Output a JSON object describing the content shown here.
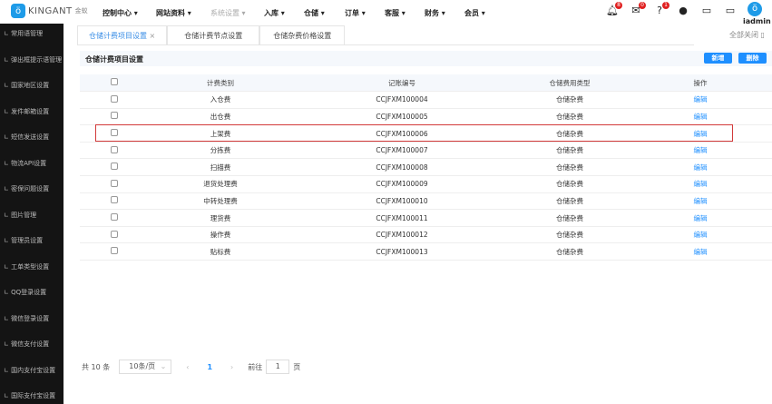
{
  "brand": {
    "name": "KINGANT",
    "cn": "金蚁"
  },
  "topnav": [
    {
      "label": "控制中心 ▾"
    },
    {
      "label": "网站资料 ▾"
    },
    {
      "label": "系统设置 ▾"
    },
    {
      "label": "入库 ▾"
    },
    {
      "label": "仓储 ▾"
    },
    {
      "label": "订单 ▾"
    },
    {
      "label": "客服 ▾"
    },
    {
      "label": "财务 ▾"
    },
    {
      "label": "会员 ▾"
    }
  ],
  "header_icons": {
    "notifications": "8",
    "messages": "0",
    "help": "1"
  },
  "user": {
    "name": "iadmin"
  },
  "sidebar": [
    "常用语管理",
    "弹出框提示语管理",
    "国家地区设置",
    "发件邮箱设置",
    "短信发送设置",
    "物流API设置",
    "密保问题设置",
    "图片管理",
    "管理员设置",
    "工单类型设置",
    "QQ登录设置",
    "微信登录设置",
    "微信支付设置",
    "国内支付宝设置",
    "国际支付宝设置"
  ],
  "tabs": [
    {
      "label": "仓储计费项目设置"
    },
    {
      "label": "仓储计费节点设置"
    },
    {
      "label": "仓储杂费价格设置"
    }
  ],
  "close_all": "全部关闭",
  "page": {
    "title": "仓储计费项目设置",
    "add": "新增",
    "delete": "删除"
  },
  "table": {
    "headers": [
      "计费类别",
      "记账编号",
      "仓储费用类型",
      "操作"
    ],
    "rows": [
      [
        "入仓费",
        "CCJFXM100004",
        "仓储杂费",
        "编辑"
      ],
      [
        "出仓费",
        "CCJFXM100005",
        "仓储杂费",
        "编辑"
      ],
      [
        "上架费",
        "CCJFXM100006",
        "仓储杂费",
        "编辑"
      ],
      [
        "分拣费",
        "CCJFXM100007",
        "仓储杂费",
        "编辑"
      ],
      [
        "扫描费",
        "CCJFXM100008",
        "仓储杂费",
        "编辑"
      ],
      [
        "退货处理费",
        "CCJFXM100009",
        "仓储杂费",
        "编辑"
      ],
      [
        "中转处理费",
        "CCJFXM100010",
        "仓储杂费",
        "编辑"
      ],
      [
        "理货费",
        "CCJFXM100011",
        "仓储杂费",
        "编辑"
      ],
      [
        "操作费",
        "CCJFXM100012",
        "仓储杂费",
        "编辑"
      ],
      [
        "贴标费",
        "CCJFXM100013",
        "仓储杂费",
        "编辑"
      ]
    ]
  },
  "pagination": {
    "total": "共 10 条",
    "page_size": "10条/页",
    "prev": "‹",
    "current": "1",
    "next": "›",
    "goto": "前往",
    "goto_value": "1",
    "page_unit": "页"
  },
  "colors": {
    "accent": "#1e8fff",
    "sidebar": "#141414",
    "highlight": "#d23a3a"
  }
}
